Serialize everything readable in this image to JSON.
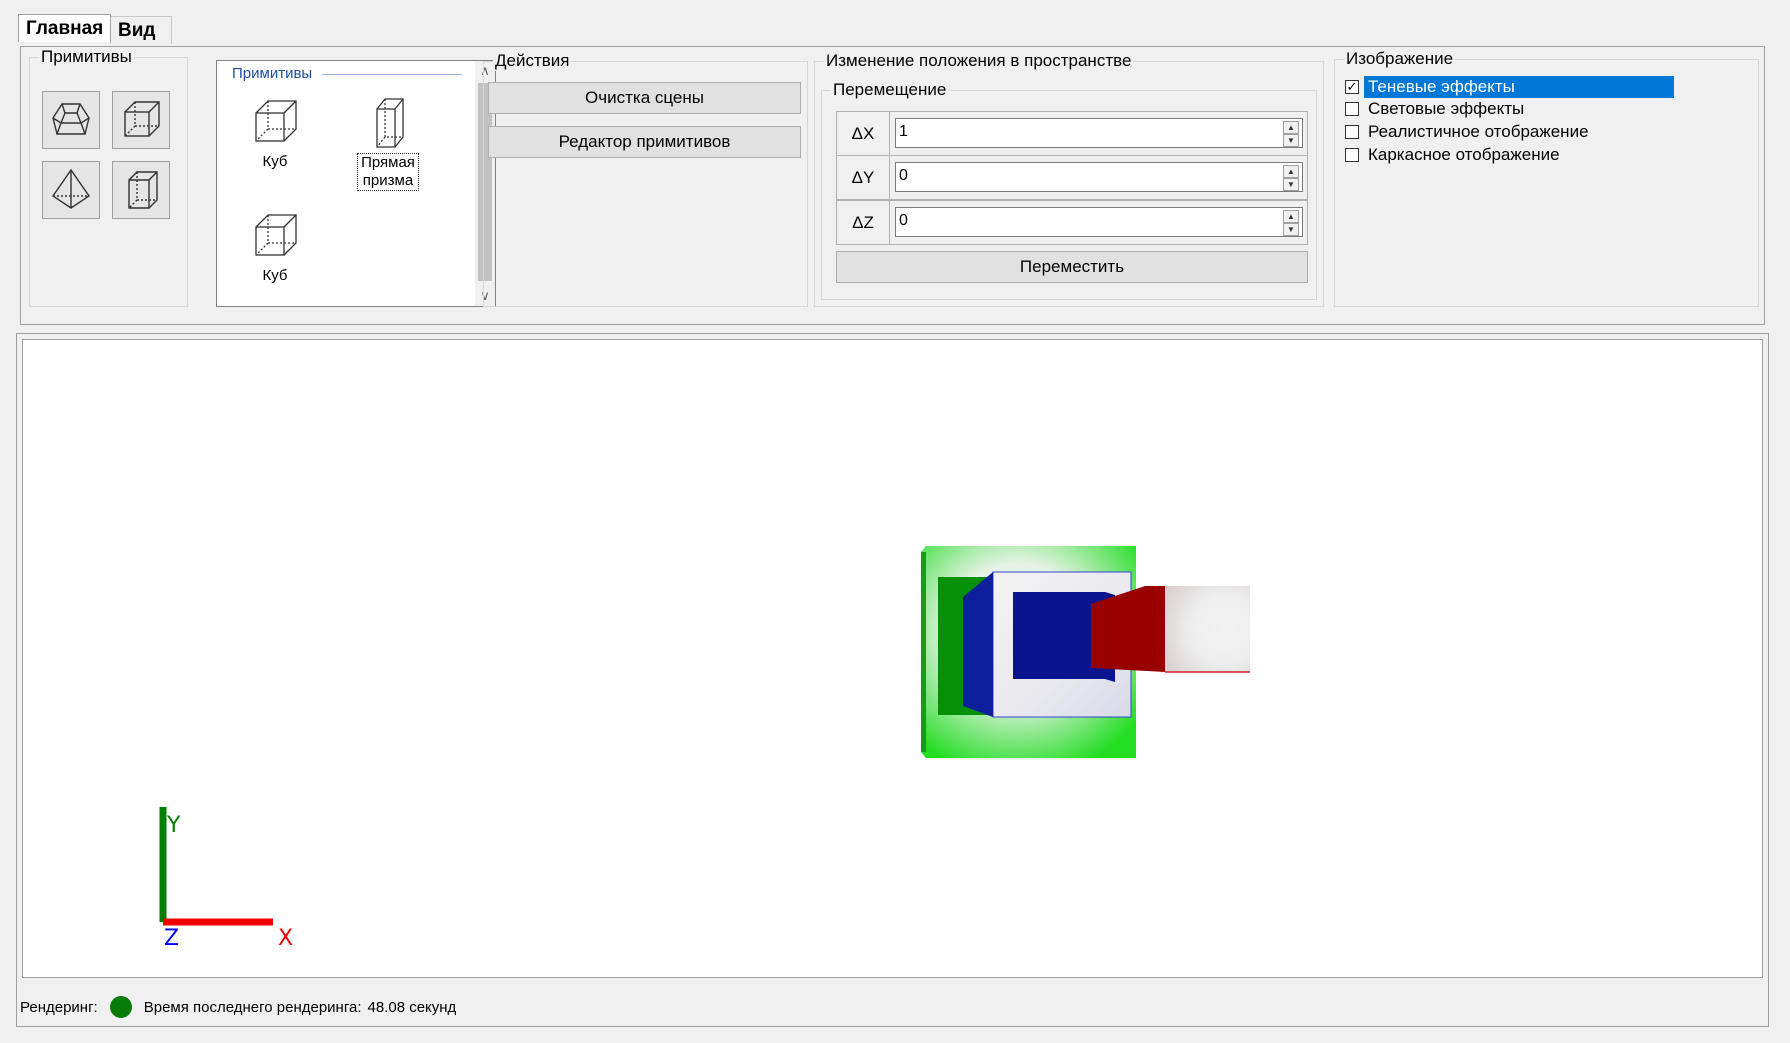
{
  "tabs": [
    {
      "label": "Главная",
      "active": true
    },
    {
      "label": "Вид",
      "active": false
    }
  ],
  "ribbon": {
    "primitives_group": {
      "title": "Примитивы",
      "buttons": [
        "truncated-pyramid-icon",
        "cube-icon",
        "pyramid-icon",
        "prism-icon"
      ]
    },
    "primitives_list": {
      "title": "Примитивы",
      "items": [
        {
          "label": "Куб",
          "icon": "cube-icon"
        },
        {
          "label": "Прямая призма",
          "icon": "prism-icon",
          "selected": true
        },
        {
          "label": "Куб",
          "icon": "cube-icon"
        }
      ]
    },
    "actions": {
      "title": "Действия",
      "clear_label": "Очистка сцены",
      "editor_label": "Редактор примитивов"
    },
    "position": {
      "title": "Изменение положения в пространстве",
      "move_title": "Перемещение",
      "dx_label": "ΔX",
      "dx_value": "1",
      "dy_label": "ΔY",
      "dy_value": "0",
      "dz_label": "ΔZ",
      "dz_value": "0",
      "move_button": "Переместить"
    },
    "image": {
      "title": "Изображение",
      "options": [
        {
          "label": "Теневые эффекты",
          "checked": true
        },
        {
          "label": "Световые эффекты",
          "checked": false
        },
        {
          "label": "Реалистичное отображение",
          "checked": false
        },
        {
          "label": "Каркасное отображение",
          "checked": false
        }
      ]
    }
  },
  "axes": {
    "y": "Y",
    "x": "X",
    "z": "Z",
    "x_color": "#ee0000",
    "y_color": "#008000",
    "z_color": "#0000ff"
  },
  "status": {
    "render_label": "Рендеринг:",
    "render_state_color": "#087a08",
    "last_render_label": "Время последнего рендеринга:",
    "last_render_value": "48.08 секунд"
  }
}
